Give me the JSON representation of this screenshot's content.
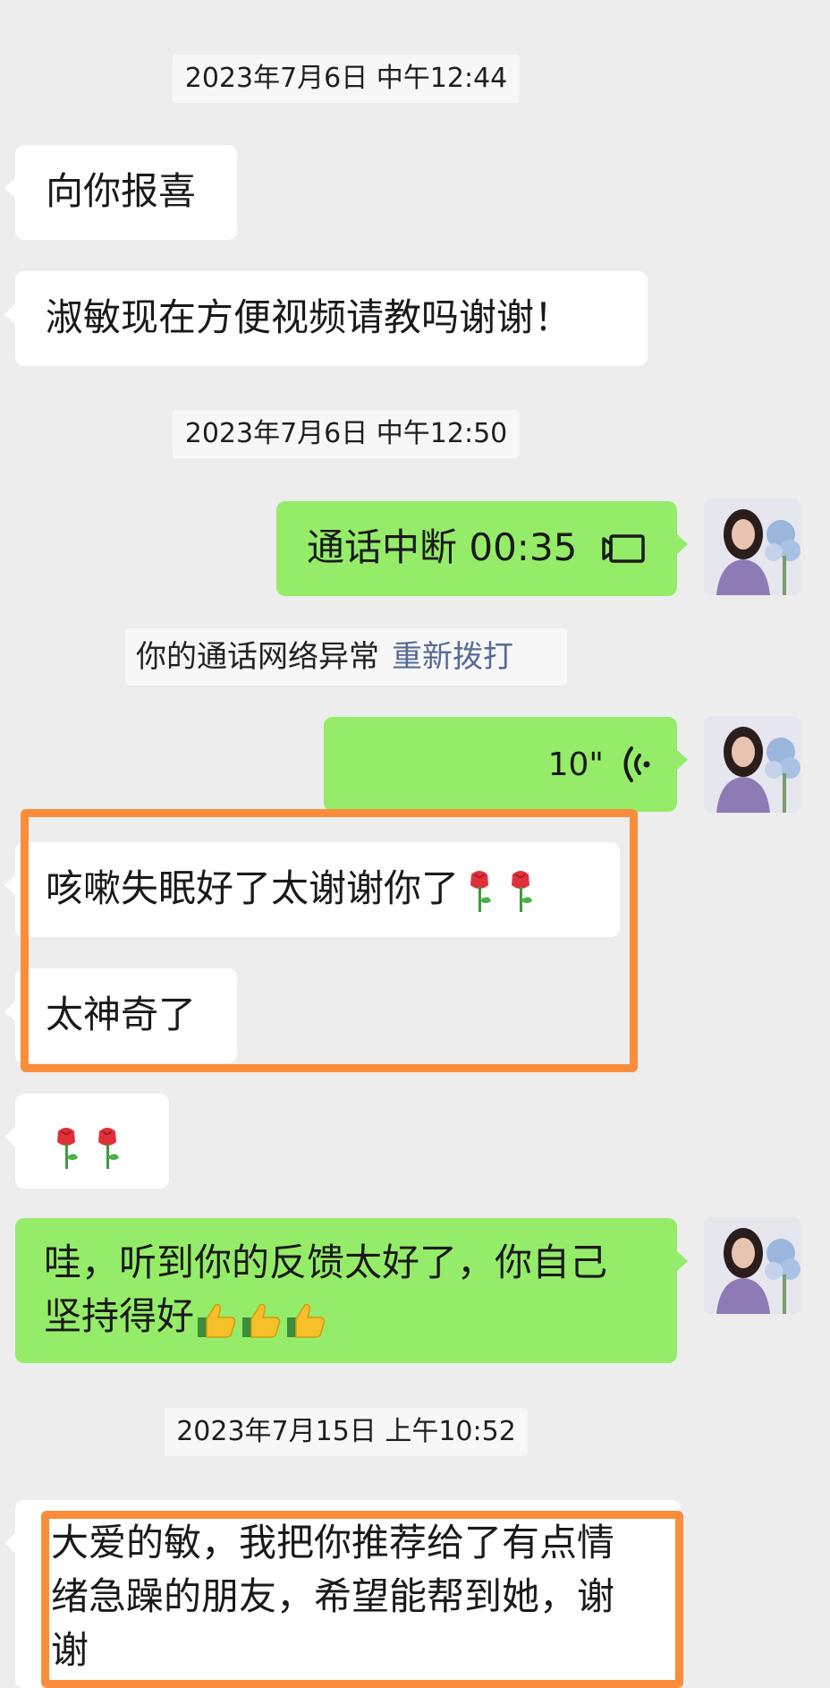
{
  "timestamps": {
    "t1": "2023年7月6日 中午12:44",
    "t2": "2023年7月6日 中午12:50",
    "t3": "2023年7月15日 上午10:52"
  },
  "messages": {
    "m1": "向你报喜",
    "m2": "淑敏现在方便视频请教吗谢谢！",
    "call": "通话中断 00:35",
    "voice_duration": "10\"",
    "m3": "咳嗽失眠好了太谢谢你了",
    "m4": "太神奇了",
    "m5_line1": "哇，听到你的反馈太好了，你自己",
    "m5_line2": "坚持得好",
    "m6_line1": "大爱的敏，我把你推荐给了有点情",
    "m6_line2": "绪急躁的朋友，希望能帮到她，谢",
    "m6_line3": "谢"
  },
  "system": {
    "notice": "你的通话网络异常",
    "redial": "重新拨打"
  },
  "colors": {
    "outgoing_bubble": "#95ec69",
    "incoming_bubble": "#ffffff",
    "highlight": "#fa8d3c",
    "link": "#576b95"
  },
  "icons": [
    "video-call-icon",
    "voice-wave-icon",
    "rose-emoji",
    "thumbs-up-emoji",
    "avatar"
  ]
}
